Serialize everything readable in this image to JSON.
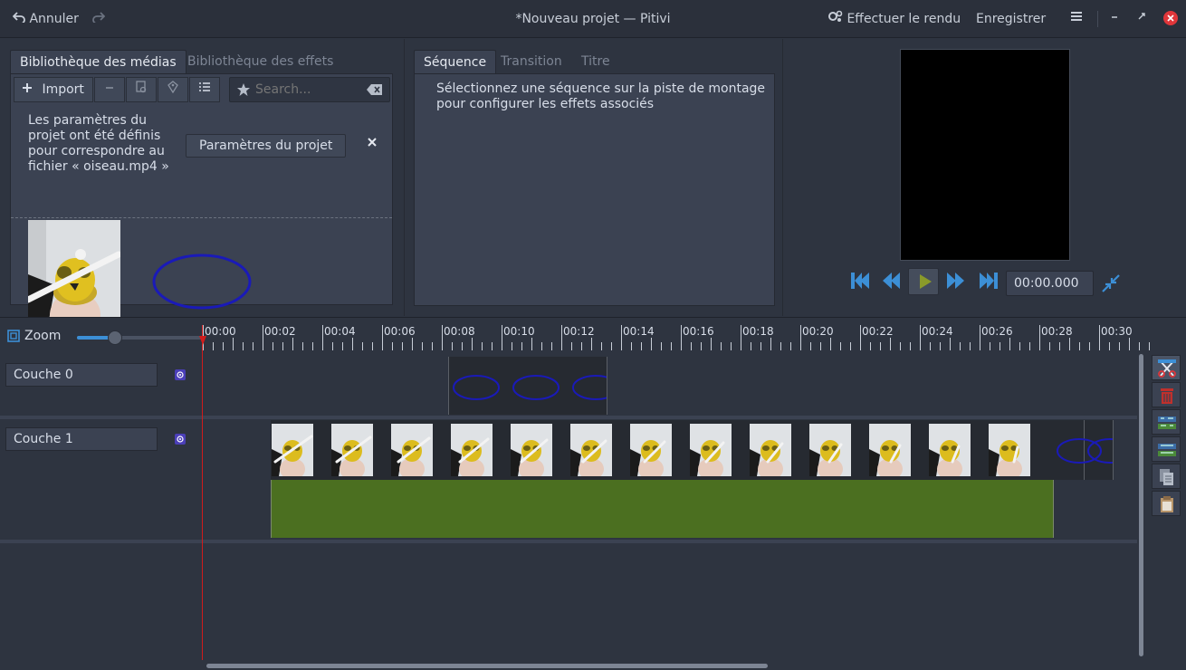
{
  "header": {
    "undo_label": "Annuler",
    "title": "*Nouveau projet — Pitivi",
    "render_label": "Effectuer le rendu",
    "save_label": "Enregistrer"
  },
  "media_library": {
    "tabs": [
      "Bibliothèque des médias",
      "Bibliothèque des effets"
    ],
    "import_label": "Import",
    "search_placeholder": "Search...",
    "notice_text": [
      "Les paramètres du",
      "projet ont été définis",
      "pour correspondre au",
      "fichier « oiseau.mp4 »"
    ],
    "project_settings_label": "Paramètres du projet"
  },
  "clip_panel": {
    "tabs": [
      "Séquence",
      "Transition",
      "Titre"
    ],
    "message": [
      "Sélectionnez une séquence sur la piste de montage",
      "pour configurer les effets associés"
    ]
  },
  "viewer": {
    "timecode": "00:00.000"
  },
  "timeline": {
    "zoom_label": "Zoom",
    "zoom_level": 0.3,
    "ruler": [
      "00:00",
      "00:02",
      "00:04",
      "00:06",
      "00:08",
      "00:10",
      "00:12",
      "00:14",
      "00:16",
      "00:18",
      "00:20",
      "00:22",
      "00:24",
      "00:26",
      "00:28",
      "00:30"
    ],
    "layers": [
      "Couche 0",
      "Couche 1"
    ]
  },
  "colors": {
    "accent_blue": "#3c8fd6",
    "audio_clip": "#4b6f20",
    "playhead": "#d01c1c",
    "ellipse": "#1a1ab8"
  },
  "icons": [
    "undo-icon",
    "redo-icon",
    "render-icon",
    "menu-icon",
    "minimize-icon",
    "restore-icon",
    "close-icon",
    "add-icon",
    "remove-icon",
    "preview-icon",
    "tag-icon",
    "list-view-icon",
    "star-icon",
    "clear-search-icon",
    "skip-start-icon",
    "rewind-icon",
    "play-icon",
    "forward-icon",
    "skip-end-icon",
    "fullscreen-icon",
    "zoom-fit-icon",
    "split-icon",
    "delete-icon",
    "group-icon",
    "ungroup-icon",
    "copy-icon",
    "paste-icon"
  ]
}
